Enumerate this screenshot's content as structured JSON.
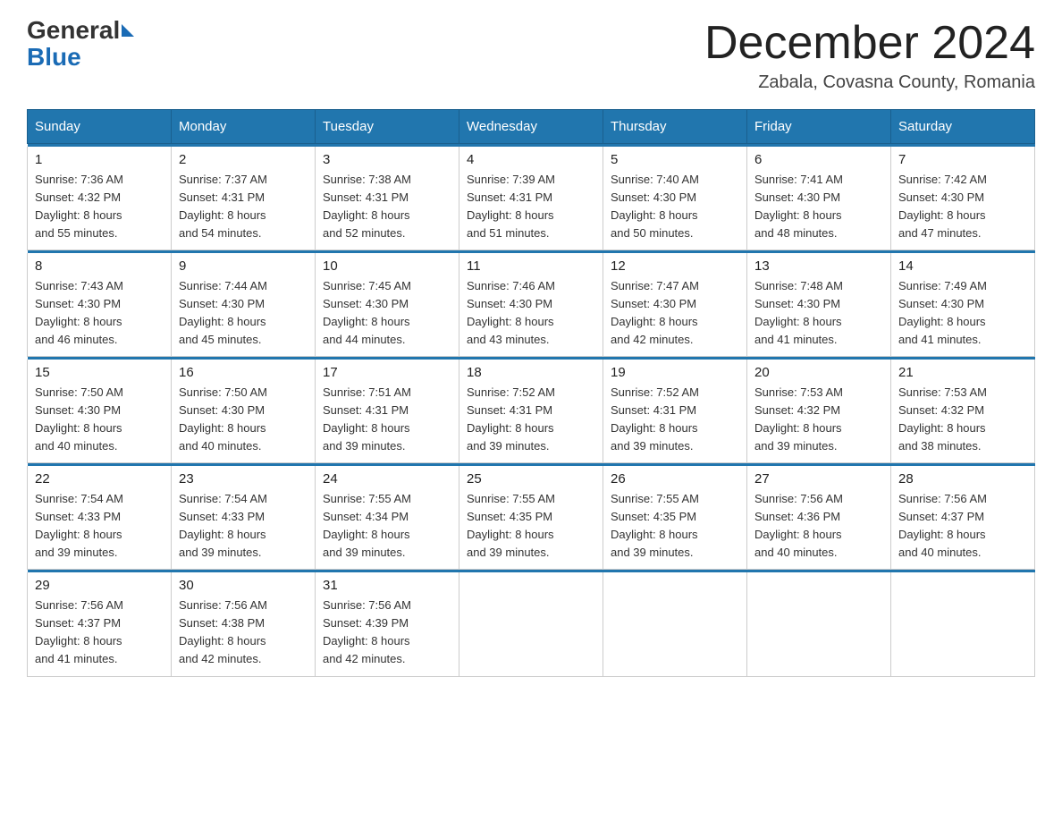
{
  "header": {
    "logo_text_general": "General",
    "logo_text_blue": "Blue",
    "month_title": "December 2024",
    "location": "Zabala, Covasna County, Romania"
  },
  "days_of_week": [
    "Sunday",
    "Monday",
    "Tuesday",
    "Wednesday",
    "Thursday",
    "Friday",
    "Saturday"
  ],
  "weeks": [
    [
      {
        "day": "1",
        "sunrise": "7:36 AM",
        "sunset": "4:32 PM",
        "daylight": "8 hours and 55 minutes."
      },
      {
        "day": "2",
        "sunrise": "7:37 AM",
        "sunset": "4:31 PM",
        "daylight": "8 hours and 54 minutes."
      },
      {
        "day": "3",
        "sunrise": "7:38 AM",
        "sunset": "4:31 PM",
        "daylight": "8 hours and 52 minutes."
      },
      {
        "day": "4",
        "sunrise": "7:39 AM",
        "sunset": "4:31 PM",
        "daylight": "8 hours and 51 minutes."
      },
      {
        "day": "5",
        "sunrise": "7:40 AM",
        "sunset": "4:30 PM",
        "daylight": "8 hours and 50 minutes."
      },
      {
        "day": "6",
        "sunrise": "7:41 AM",
        "sunset": "4:30 PM",
        "daylight": "8 hours and 48 minutes."
      },
      {
        "day": "7",
        "sunrise": "7:42 AM",
        "sunset": "4:30 PM",
        "daylight": "8 hours and 47 minutes."
      }
    ],
    [
      {
        "day": "8",
        "sunrise": "7:43 AM",
        "sunset": "4:30 PM",
        "daylight": "8 hours and 46 minutes."
      },
      {
        "day": "9",
        "sunrise": "7:44 AM",
        "sunset": "4:30 PM",
        "daylight": "8 hours and 45 minutes."
      },
      {
        "day": "10",
        "sunrise": "7:45 AM",
        "sunset": "4:30 PM",
        "daylight": "8 hours and 44 minutes."
      },
      {
        "day": "11",
        "sunrise": "7:46 AM",
        "sunset": "4:30 PM",
        "daylight": "8 hours and 43 minutes."
      },
      {
        "day": "12",
        "sunrise": "7:47 AM",
        "sunset": "4:30 PM",
        "daylight": "8 hours and 42 minutes."
      },
      {
        "day": "13",
        "sunrise": "7:48 AM",
        "sunset": "4:30 PM",
        "daylight": "8 hours and 41 minutes."
      },
      {
        "day": "14",
        "sunrise": "7:49 AM",
        "sunset": "4:30 PM",
        "daylight": "8 hours and 41 minutes."
      }
    ],
    [
      {
        "day": "15",
        "sunrise": "7:50 AM",
        "sunset": "4:30 PM",
        "daylight": "8 hours and 40 minutes."
      },
      {
        "day": "16",
        "sunrise": "7:50 AM",
        "sunset": "4:30 PM",
        "daylight": "8 hours and 40 minutes."
      },
      {
        "day": "17",
        "sunrise": "7:51 AM",
        "sunset": "4:31 PM",
        "daylight": "8 hours and 39 minutes."
      },
      {
        "day": "18",
        "sunrise": "7:52 AM",
        "sunset": "4:31 PM",
        "daylight": "8 hours and 39 minutes."
      },
      {
        "day": "19",
        "sunrise": "7:52 AM",
        "sunset": "4:31 PM",
        "daylight": "8 hours and 39 minutes."
      },
      {
        "day": "20",
        "sunrise": "7:53 AM",
        "sunset": "4:32 PM",
        "daylight": "8 hours and 39 minutes."
      },
      {
        "day": "21",
        "sunrise": "7:53 AM",
        "sunset": "4:32 PM",
        "daylight": "8 hours and 38 minutes."
      }
    ],
    [
      {
        "day": "22",
        "sunrise": "7:54 AM",
        "sunset": "4:33 PM",
        "daylight": "8 hours and 39 minutes."
      },
      {
        "day": "23",
        "sunrise": "7:54 AM",
        "sunset": "4:33 PM",
        "daylight": "8 hours and 39 minutes."
      },
      {
        "day": "24",
        "sunrise": "7:55 AM",
        "sunset": "4:34 PM",
        "daylight": "8 hours and 39 minutes."
      },
      {
        "day": "25",
        "sunrise": "7:55 AM",
        "sunset": "4:35 PM",
        "daylight": "8 hours and 39 minutes."
      },
      {
        "day": "26",
        "sunrise": "7:55 AM",
        "sunset": "4:35 PM",
        "daylight": "8 hours and 39 minutes."
      },
      {
        "day": "27",
        "sunrise": "7:56 AM",
        "sunset": "4:36 PM",
        "daylight": "8 hours and 40 minutes."
      },
      {
        "day": "28",
        "sunrise": "7:56 AM",
        "sunset": "4:37 PM",
        "daylight": "8 hours and 40 minutes."
      }
    ],
    [
      {
        "day": "29",
        "sunrise": "7:56 AM",
        "sunset": "4:37 PM",
        "daylight": "8 hours and 41 minutes."
      },
      {
        "day": "30",
        "sunrise": "7:56 AM",
        "sunset": "4:38 PM",
        "daylight": "8 hours and 42 minutes."
      },
      {
        "day": "31",
        "sunrise": "7:56 AM",
        "sunset": "4:39 PM",
        "daylight": "8 hours and 42 minutes."
      },
      null,
      null,
      null,
      null
    ]
  ],
  "labels": {
    "sunrise": "Sunrise:",
    "sunset": "Sunset:",
    "daylight": "Daylight:"
  }
}
